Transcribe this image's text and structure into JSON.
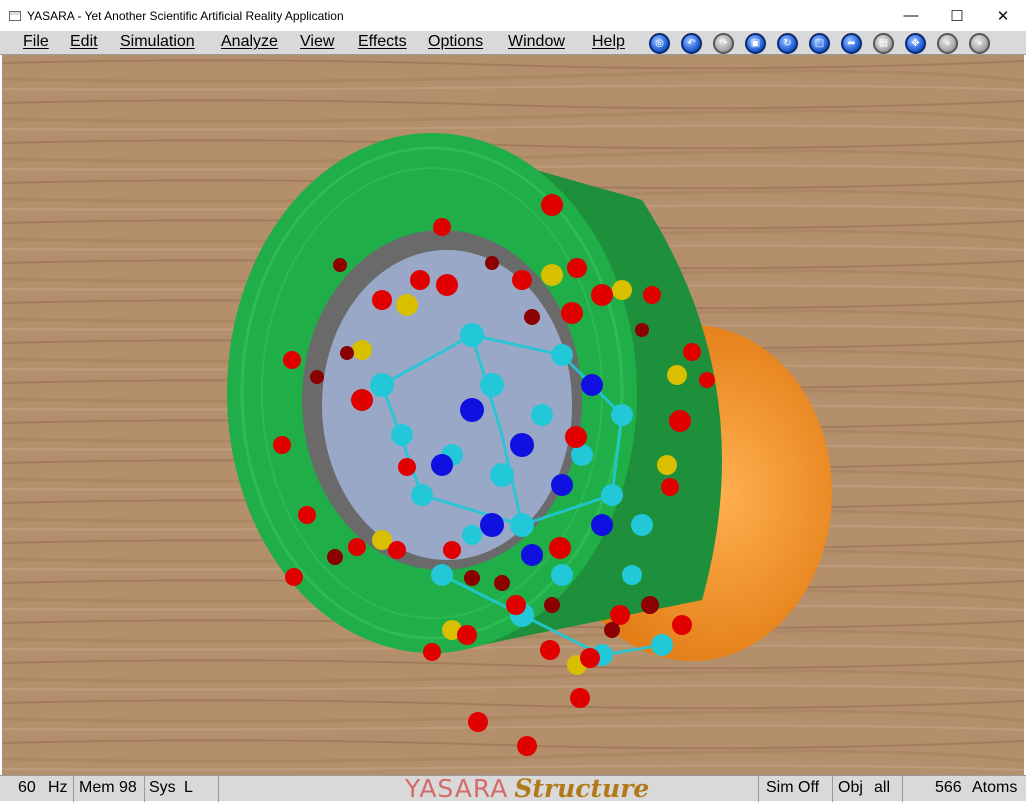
{
  "window": {
    "title": "YASARA - Yet Another Scientific Artificial Reality Application",
    "minimize_glyph": "—",
    "maximize_glyph": "☐",
    "close_glyph": "✕"
  },
  "menu": {
    "items": [
      "File",
      "Edit",
      "Simulation",
      "Analyze",
      "View",
      "Effects",
      "Options",
      "Window",
      "Help"
    ]
  },
  "toolbar": {
    "icons": [
      "center-icon",
      "undo-icon",
      "redo-icon",
      "select-icon",
      "rotate-icon",
      "new-scene-icon",
      "open-icon",
      "save-icon",
      "move-icon",
      "rewind-icon",
      "fast-forward-icon"
    ],
    "glyphs": [
      "◎",
      "↶",
      "↷",
      "▣",
      "↻",
      "□",
      "➦",
      "▤",
      "✥",
      "«",
      "»"
    ]
  },
  "scene": {
    "background_color": "#b48f6c",
    "tape_color": "#1fae47",
    "cup_color": "#f08a1e",
    "atom_colors": {
      "oxygen": "#e00000",
      "carbon": "#22c8d8",
      "nitrogen": "#1010e0",
      "phosphorus": "#d8c000",
      "dark_oxygen": "#8b0000"
    }
  },
  "status": {
    "fps_value": "60",
    "fps_unit": "Hz",
    "mem_label": "Mem",
    "mem_value": "98",
    "sys_label": "Sys",
    "sys_value": "L",
    "brand_yasara": "YASARA",
    "brand_structure": "Structure",
    "sim_state": "Sim Off",
    "obj_label": "Obj",
    "obj_value": "all",
    "atoms_count": "566",
    "atoms_label": "Atoms"
  }
}
